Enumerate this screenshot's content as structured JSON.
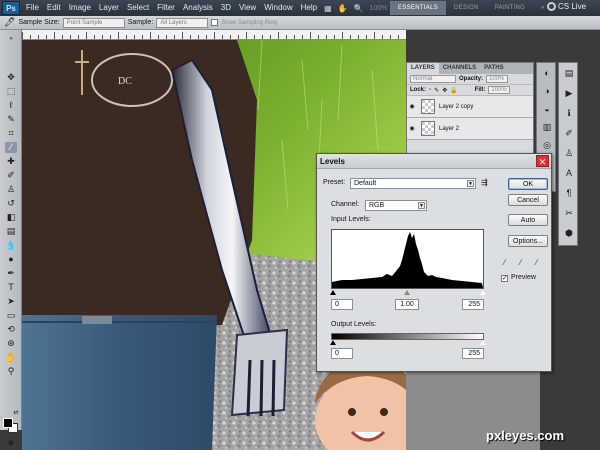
{
  "app": {
    "logo": "Ps",
    "menu": [
      "File",
      "Edit",
      "Image",
      "Layer",
      "Select",
      "Filter",
      "Analysis",
      "3D",
      "View",
      "Window",
      "Help"
    ],
    "zoom": "100%",
    "workspaces": [
      "ESSENTIALS",
      "DESIGN",
      "PAINTING"
    ],
    "active_workspace": "ESSENTIALS",
    "cs_live": "CS Live"
  },
  "options_bar": {
    "sample_size_label": "Sample Size:",
    "sample_size_value": "Point Sample",
    "sample_label": "Sample:",
    "sample_value": "All Layers",
    "show_ring_label": "Show Sampling Ring"
  },
  "layers_panel": {
    "tabs": [
      "LAYERS",
      "CHANNELS",
      "PATHS"
    ],
    "blend_mode": "Normal",
    "opacity_label": "Opacity:",
    "opacity_value": "100%",
    "lock_label": "Lock:",
    "fill_label": "Fill:",
    "fill_value": "100%",
    "layers": [
      "Layer 2 copy",
      "Layer 2"
    ]
  },
  "levels": {
    "title": "Levels",
    "preset_label": "Preset:",
    "preset_value": "Default",
    "channel_label": "Channel:",
    "channel_value": "RGB",
    "input_label": "Input Levels:",
    "input_black": "0",
    "input_mid": "1.00",
    "input_white": "255",
    "output_label": "Output Levels:",
    "output_black": "0",
    "output_white": "255",
    "buttons": {
      "ok": "OK",
      "cancel": "Cancel",
      "auto": "Auto",
      "options": "Options..."
    },
    "preview_label": "Preview",
    "preview_checked": true
  },
  "watermark": "pxleyes.com"
}
